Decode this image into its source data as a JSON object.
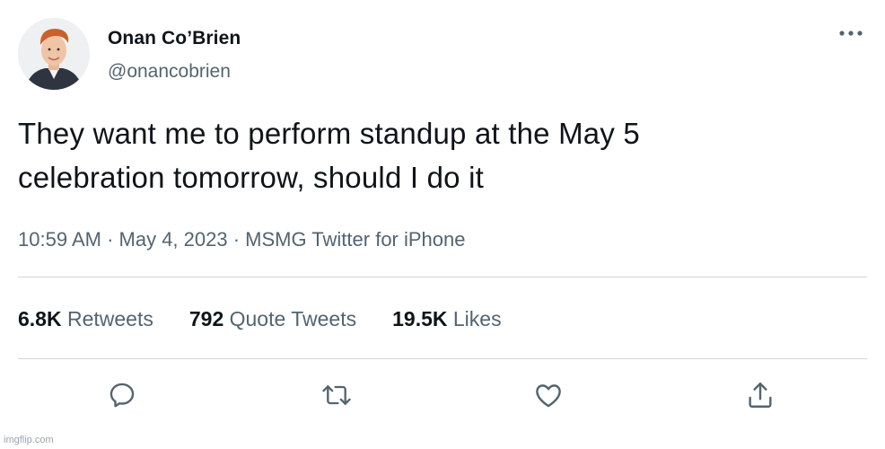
{
  "author": {
    "display_name": "Onan Co’Brien",
    "handle": "@onancobrien"
  },
  "tweet": {
    "text_line1": "They want me to perform standup at the May 5",
    "text_line2": "celebration tomorrow, should I do it",
    "time": "10:59 AM",
    "date": "May 4, 2023",
    "source": "MSMG Twitter for iPhone",
    "separator": " · "
  },
  "stats": {
    "retweets_count": "6.8K",
    "retweets_label": "Retweets",
    "quotes_count": "792",
    "quotes_label": "Quote Tweets",
    "likes_count": "19.5K",
    "likes_label": "Likes"
  },
  "icons": {
    "more": "more-horizontal-icon",
    "reply": "reply-icon",
    "retweet": "retweet-icon",
    "like": "heart-icon",
    "share": "share-icon"
  },
  "colors": {
    "text_primary": "#0f1419",
    "text_secondary": "#536471",
    "divider": "#cfd9de"
  },
  "watermark": "imgflip.com"
}
